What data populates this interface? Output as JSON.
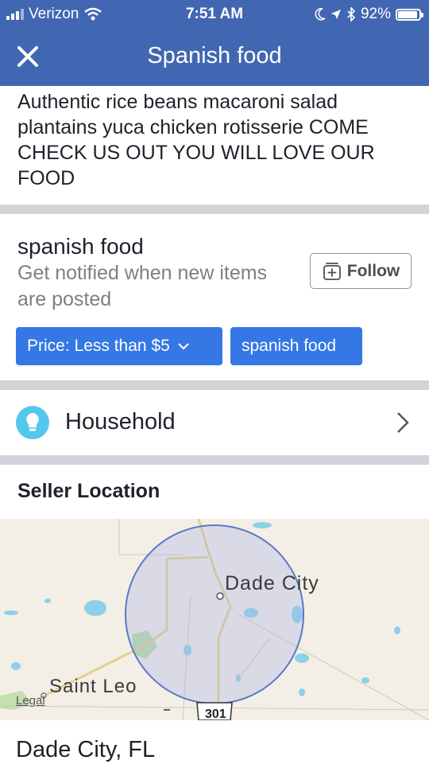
{
  "status": {
    "carrier": "Verizon",
    "time": "7:51 AM",
    "battery": "92%",
    "battery_level": 0.92
  },
  "header": {
    "title": "Spanish food"
  },
  "description": "Authentic rice beans macaroni salad plantains yuca chicken rotisserie  COME CHECK US OUT YOU WILL LOVE OUR FOOD",
  "subscription": {
    "title": "spanish food",
    "text": "Get notified when new items are posted",
    "follow_label": "Follow"
  },
  "filters": [
    {
      "label": "Price: Less than $5"
    },
    {
      "label": "spanish food"
    }
  ],
  "category": {
    "label": "Household",
    "icon": "lightbulb-icon"
  },
  "seller_location": {
    "heading": "Seller Location",
    "map_labels": {
      "city": "Dade City",
      "town": "Saint Leo",
      "legal": "Legal",
      "route": "301"
    },
    "city_state": "Dade City, FL"
  },
  "colors": {
    "brand": "#4267b2",
    "chip": "#3578e5",
    "divider": "#d1d4d8"
  }
}
